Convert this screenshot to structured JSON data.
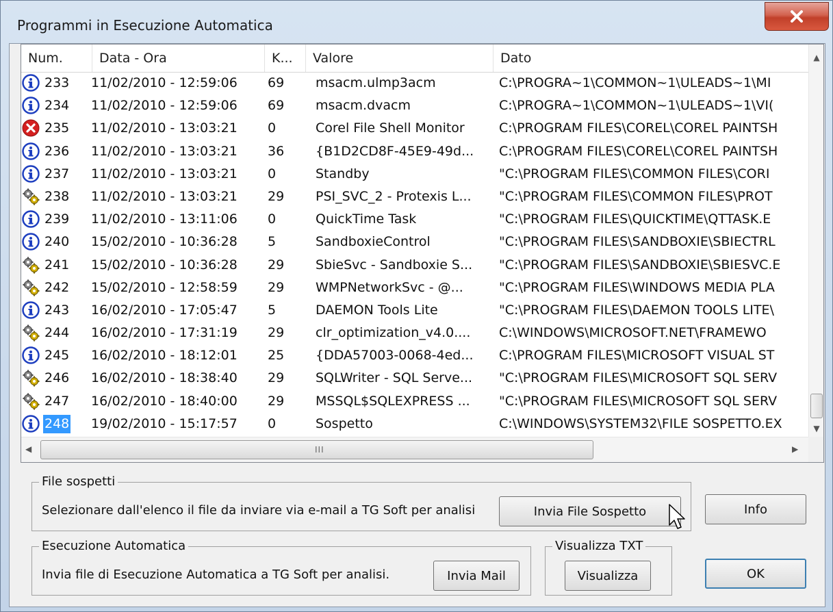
{
  "window": {
    "title": "Programmi in Esecuzione Automatica"
  },
  "columns": [
    "Num.",
    "Data - Ora",
    "K...",
    "Valore",
    "Dato"
  ],
  "rows": [
    {
      "icon": "info",
      "num": "233",
      "date": "11/02/2010 - 12:59:06",
      "k": "69",
      "valore": "msacm.ulmp3acm",
      "dato": "C:\\PROGRA~1\\COMMON~1\\ULEADS~1\\MI"
    },
    {
      "icon": "info",
      "num": "234",
      "date": "11/02/2010 - 12:59:06",
      "k": "69",
      "valore": "msacm.dvacm",
      "dato": "C:\\PROGRA~1\\COMMON~1\\ULEADS~1\\VI("
    },
    {
      "icon": "error",
      "num": "235",
      "date": "11/02/2010 - 13:03:21",
      "k": "0",
      "valore": "Corel File Shell Monitor",
      "dato": "C:\\PROGRAM FILES\\COREL\\COREL PAINTSH"
    },
    {
      "icon": "info",
      "num": "236",
      "date": "11/02/2010 - 13:03:21",
      "k": "36",
      "valore": "{B1D2CD8F-45E9-49d...",
      "dato": "C:\\PROGRAM FILES\\COREL\\COREL PAINTSH"
    },
    {
      "icon": "info",
      "num": "237",
      "date": "11/02/2010 - 13:03:21",
      "k": "0",
      "valore": "Standby",
      "dato": "\"C:\\PROGRAM FILES\\COMMON FILES\\CORI"
    },
    {
      "icon": "service",
      "num": "238",
      "date": "11/02/2010 - 13:03:21",
      "k": "29",
      "valore": "PSI_SVC_2 - Protexis L...",
      "dato": "\"C:\\PROGRAM FILES\\COMMON FILES\\PROT"
    },
    {
      "icon": "info",
      "num": "239",
      "date": "11/02/2010 - 13:11:06",
      "k": "0",
      "valore": "QuickTime Task",
      "dato": "\"C:\\PROGRAM FILES\\QUICKTIME\\QTTASK.E"
    },
    {
      "icon": "info",
      "num": "240",
      "date": "15/02/2010 - 10:36:28",
      "k": "5",
      "valore": "SandboxieControl",
      "dato": "\"C:\\PROGRAM FILES\\SANDBOXIE\\SBIECTRL"
    },
    {
      "icon": "service",
      "num": "241",
      "date": "15/02/2010 - 10:36:28",
      "k": "29",
      "valore": "SbieSvc - Sandboxie S...",
      "dato": "\"C:\\PROGRAM FILES\\SANDBOXIE\\SBIESVC.E"
    },
    {
      "icon": "service",
      "num": "242",
      "date": "15/02/2010 - 12:58:59",
      "k": "29",
      "valore": "WMPNetworkSvc - @...",
      "dato": "\"C:\\PROGRAM FILES\\WINDOWS MEDIA PLA"
    },
    {
      "icon": "info",
      "num": "243",
      "date": "16/02/2010 - 17:05:47",
      "k": "5",
      "valore": "DAEMON Tools Lite",
      "dato": "\"C:\\PROGRAM FILES\\DAEMON TOOLS LITE\\"
    },
    {
      "icon": "service",
      "num": "244",
      "date": "16/02/2010 - 17:31:19",
      "k": "29",
      "valore": "clr_optimization_v4.0....",
      "dato": "C:\\WINDOWS\\MICROSOFT.NET\\FRAMEWO"
    },
    {
      "icon": "info",
      "num": "245",
      "date": "16/02/2010 - 18:12:01",
      "k": "25",
      "valore": "{DDA57003-0068-4ed...",
      "dato": "C:\\PROGRAM FILES\\MICROSOFT VISUAL ST"
    },
    {
      "icon": "service",
      "num": "246",
      "date": "16/02/2010 - 18:38:40",
      "k": "29",
      "valore": "SQLWriter - SQL Serve...",
      "dato": "\"C:\\PROGRAM FILES\\MICROSOFT SQL SERV"
    },
    {
      "icon": "service",
      "num": "247",
      "date": "16/02/2010 - 18:40:00",
      "k": "29",
      "valore": "MSSQL$SQLEXPRESS ...",
      "dato": "\"C:\\PROGRAM FILES\\MICROSOFT SQL SERV"
    },
    {
      "icon": "info",
      "num": "248",
      "date": "19/02/2010 - 15:17:57",
      "k": "0",
      "valore": "Sospetto",
      "dato": "C:\\WINDOWS\\SYSTEM32\\FILE SOSPETTO.EX",
      "selected": true
    }
  ],
  "scroll": {
    "hgrip": "III"
  },
  "suspicious": {
    "label": "File sospetti",
    "text": "Selezionare dall'elenco il file da inviare via e-mail a TG Soft per analisi",
    "button": "Invia File Sospetto"
  },
  "info_button": "Info",
  "autorun": {
    "label": "Esecuzione Automatica",
    "text": "Invia file di Esecuzione Automatica a TG Soft per analisi.",
    "button": "Invia Mail"
  },
  "txt": {
    "label": "Visualizza TXT",
    "button": "Visualizza"
  },
  "ok_button": "OK",
  "colors": {
    "selection": "#3399ff",
    "info_icon": "#1e3fbf",
    "error_icon": "#d42020"
  }
}
